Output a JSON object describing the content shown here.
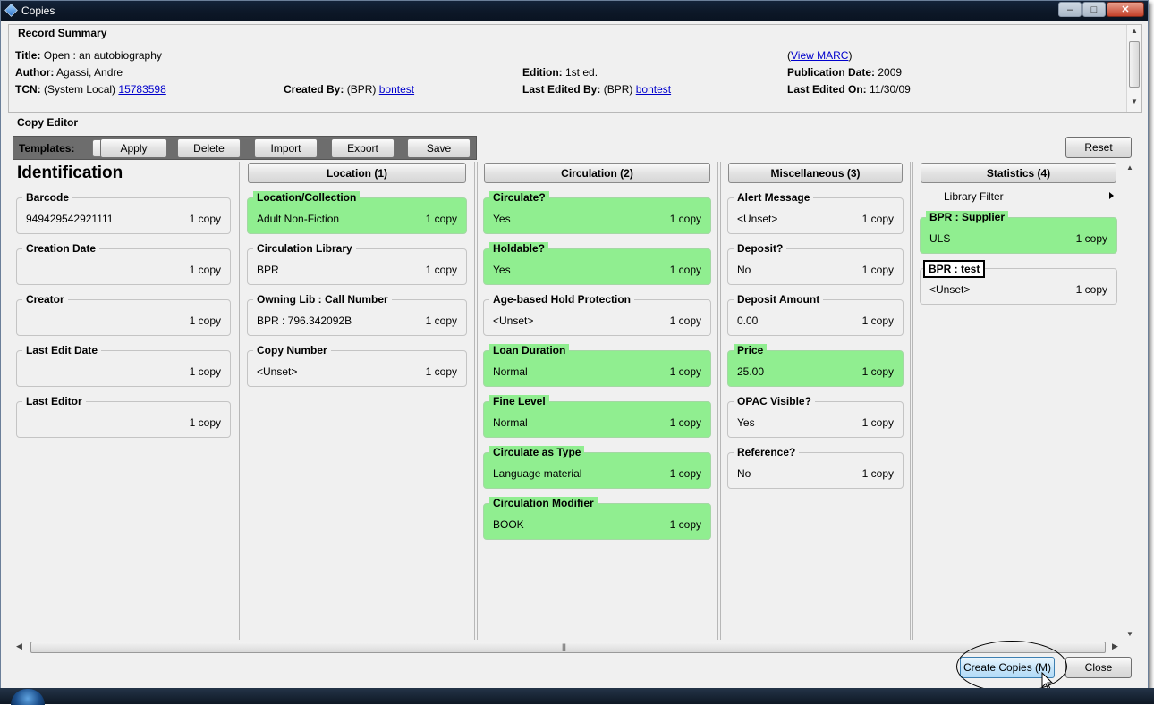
{
  "window": {
    "title": "Copies",
    "minimize_glyph": "–",
    "maximize_glyph": "□",
    "close_glyph": "✕"
  },
  "record_summary": {
    "heading": "Record Summary",
    "title_label": "Title:",
    "title_value": "Open : an autobiography",
    "author_label": "Author:",
    "author_value": "Agassi, Andre",
    "tcn_label": "TCN:",
    "tcn_source": "(System Local)",
    "tcn_value": "15783598",
    "created_by_label": "Created By:",
    "created_by_org": "(BPR)",
    "created_by_user": "bontest",
    "edition_label": "Edition:",
    "edition_value": "1st ed.",
    "last_edited_by_label": "Last Edited By:",
    "last_edited_by_org": "(BPR)",
    "last_edited_by_user": "bontest",
    "view_marc_open": "(",
    "view_marc": "View MARC",
    "view_marc_close": ")",
    "pub_date_label": "Publication Date:",
    "pub_date_value": "2009",
    "last_edited_on_label": "Last Edited On:",
    "last_edited_on_value": "11/30/09"
  },
  "copy_editor": {
    "label": "Copy Editor",
    "templates_label": "Templates:",
    "buttons": {
      "apply": "Apply",
      "delete": "Delete",
      "import": "Import",
      "export": "Export",
      "save": "Save",
      "reset": "Reset"
    },
    "identification": {
      "heading": "Identification",
      "fields": [
        {
          "label": "Barcode",
          "value": "949429542921111",
          "count": "1 copy"
        },
        {
          "label": "Creation Date",
          "value": "",
          "count": "1 copy"
        },
        {
          "label": "Creator",
          "value": "",
          "count": "1 copy"
        },
        {
          "label": "Last Edit Date",
          "value": "",
          "count": "1 copy"
        },
        {
          "label": "Last Editor",
          "value": "",
          "count": "1 copy"
        }
      ]
    },
    "location": {
      "heading": "Location (1)",
      "fields": [
        {
          "label": "Location/Collection",
          "value": "Adult Non-Fiction",
          "count": "1 copy",
          "changed": true
        },
        {
          "label": "Circulation Library",
          "value": "BPR",
          "count": "1 copy",
          "changed": false
        },
        {
          "label": "Owning Lib : Call Number",
          "value": "BPR : 796.342092B",
          "count": "1 copy",
          "changed": false
        },
        {
          "label": "Copy Number",
          "value": "<Unset>",
          "count": "1 copy",
          "changed": false
        }
      ]
    },
    "circulation": {
      "heading": "Circulation (2)",
      "fields": [
        {
          "label": "Circulate?",
          "value": "Yes",
          "count": "1 copy",
          "changed": true
        },
        {
          "label": "Holdable?",
          "value": "Yes",
          "count": "1 copy",
          "changed": true
        },
        {
          "label": "Age-based Hold Protection",
          "value": "<Unset>",
          "count": "1 copy",
          "changed": false
        },
        {
          "label": "Loan Duration",
          "value": "Normal",
          "count": "1 copy",
          "changed": true
        },
        {
          "label": "Fine Level",
          "value": "Normal",
          "count": "1 copy",
          "changed": true
        },
        {
          "label": "Circulate as Type",
          "value": "Language material",
          "count": "1 copy",
          "changed": true
        },
        {
          "label": "Circulation Modifier",
          "value": "BOOK",
          "count": "1 copy",
          "changed": true
        }
      ]
    },
    "miscellaneous": {
      "heading": "Miscellaneous (3)",
      "fields": [
        {
          "label": "Alert Message",
          "value": "<Unset>",
          "count": "1 copy",
          "changed": false
        },
        {
          "label": "Deposit?",
          "value": "No",
          "count": "1 copy",
          "changed": false
        },
        {
          "label": "Deposit Amount",
          "value": "0.00",
          "count": "1 copy",
          "changed": false
        },
        {
          "label": "Price",
          "value": "25.00",
          "count": "1 copy",
          "changed": true
        },
        {
          "label": "OPAC Visible?",
          "value": "Yes",
          "count": "1 copy",
          "changed": false
        },
        {
          "label": "Reference?",
          "value": "No",
          "count": "1 copy",
          "changed": false
        }
      ]
    },
    "statistics": {
      "heading": "Statistics (4)",
      "library_filter": "Library Filter",
      "fields": [
        {
          "label": "BPR : Supplier",
          "value": "ULS",
          "count": "1 copy",
          "changed": true
        },
        {
          "label": "BPR : test",
          "value": "<Unset>",
          "count": "1 copy",
          "changed": false
        }
      ]
    }
  },
  "footer": {
    "create_copies": "Create Copies (M)",
    "close": "Close"
  },
  "colors": {
    "changed_field": "#90ee90",
    "templates_bar": "#6d6d6d",
    "link": "#0000cc"
  }
}
